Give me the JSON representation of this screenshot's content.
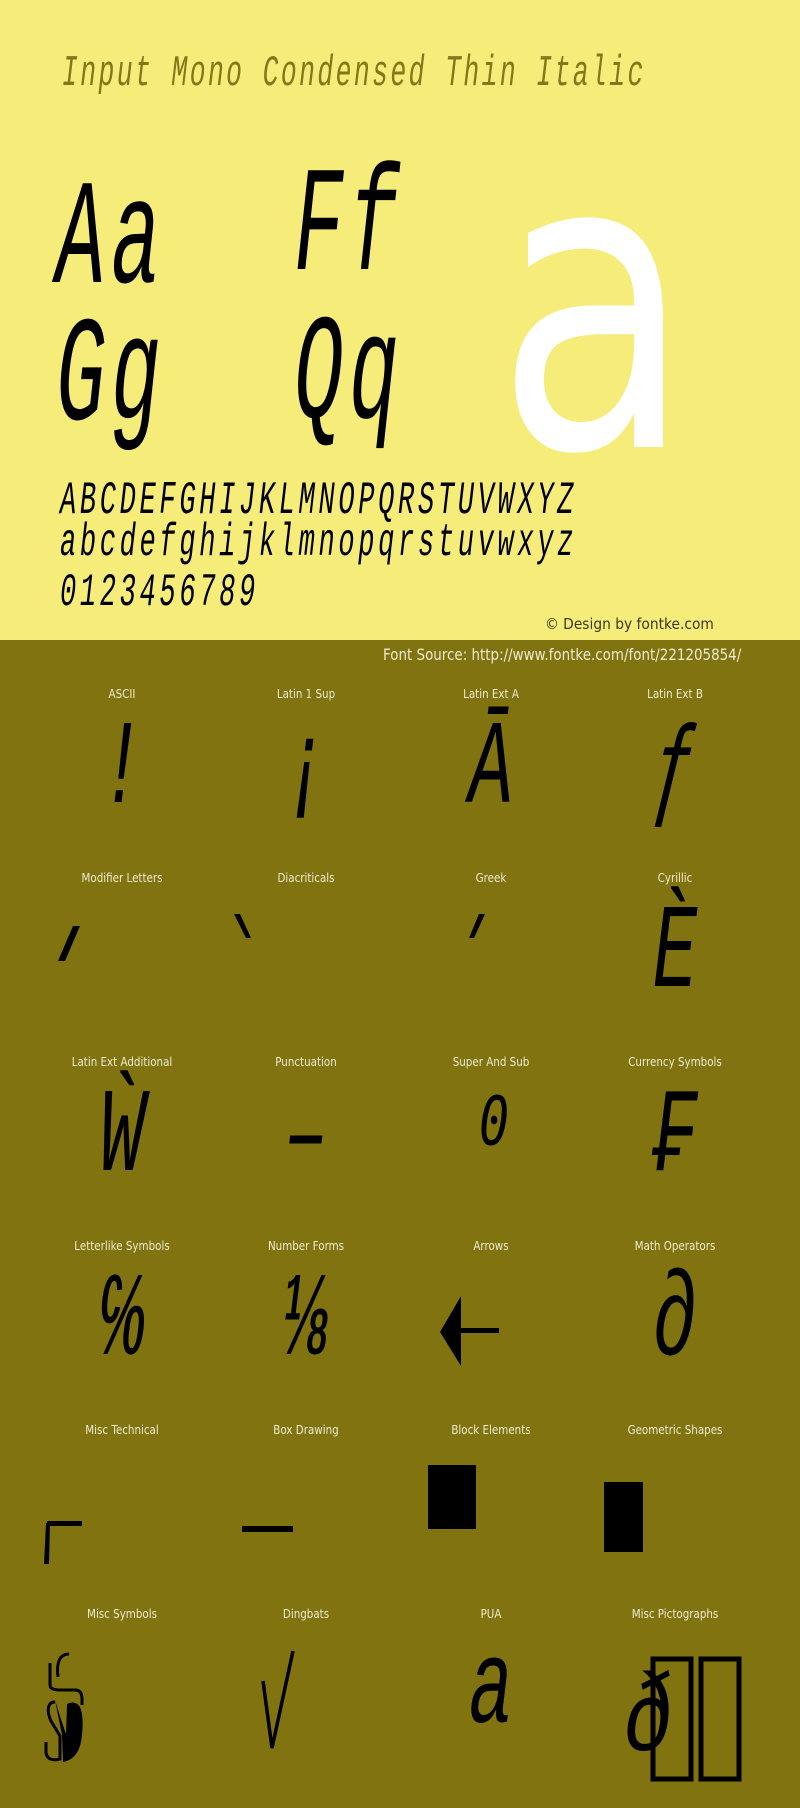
{
  "header": {
    "title": "Input Mono Condensed Thin Italic"
  },
  "specimen": {
    "pairs": [
      "Aa",
      "Ff",
      "Gg",
      "Qq"
    ],
    "big_glyph": "a",
    "uppercase": "ABCDEFGHIJKLMNOPQRSTUVWXYZ",
    "lowercase": "abcdefghijklmnopqrstuvwxyz",
    "digits": "0123456789"
  },
  "credit": "© Design by fontke.com",
  "source": "Font Source: http://www.fontke.com/font/221205854/",
  "colors": {
    "top_background": "#f5ec7a",
    "bottom_background": "#817410",
    "title_color": "#847719",
    "big_glyph_color": "#ffffff",
    "glyph_color": "#000000",
    "label_color": "#ecebd0"
  },
  "blocks": [
    {
      "label": "ASCII",
      "glyph": "!"
    },
    {
      "label": "Latin 1 Sup",
      "glyph": "¡"
    },
    {
      "label": "Latin Ext A",
      "glyph": "Ā"
    },
    {
      "label": "Latin Ext B",
      "glyph": "ƒ"
    },
    {
      "label": "Modifier Letters",
      "glyph": "ˊ"
    },
    {
      "label": "Diacriticals",
      "glyph": "̀"
    },
    {
      "label": "Greek",
      "glyph": "΄"
    },
    {
      "label": "Cyrillic",
      "glyph": "Ѐ"
    },
    {
      "label": "Latin Ext Additional",
      "glyph": "Ẁ"
    },
    {
      "label": "Punctuation",
      "glyph": "–"
    },
    {
      "label": "Super And Sub",
      "glyph": "⁰"
    },
    {
      "label": "Currency Symbols",
      "glyph": "₣"
    },
    {
      "label": "Letterlike Symbols",
      "glyph": "℅"
    },
    {
      "label": "Number Forms",
      "glyph": "⅛"
    },
    {
      "label": "Arrows",
      "glyph": "←"
    },
    {
      "label": "Math Operators",
      "glyph": "∂"
    },
    {
      "label": "Misc Technical",
      "glyph": "⌈"
    },
    {
      "label": "Box Drawing",
      "glyph": "─"
    },
    {
      "label": "Block Elements",
      "glyph": "█"
    },
    {
      "label": "Geometric Shapes",
      "glyph": "■"
    },
    {
      "label": "Misc Symbols",
      "glyph": "☙"
    },
    {
      "label": "Dingbats",
      "glyph": "✓"
    },
    {
      "label": "PUA",
      "glyph": "a"
    },
    {
      "label": "Misc Pictographs",
      "glyph": "ð▯▯"
    }
  ]
}
